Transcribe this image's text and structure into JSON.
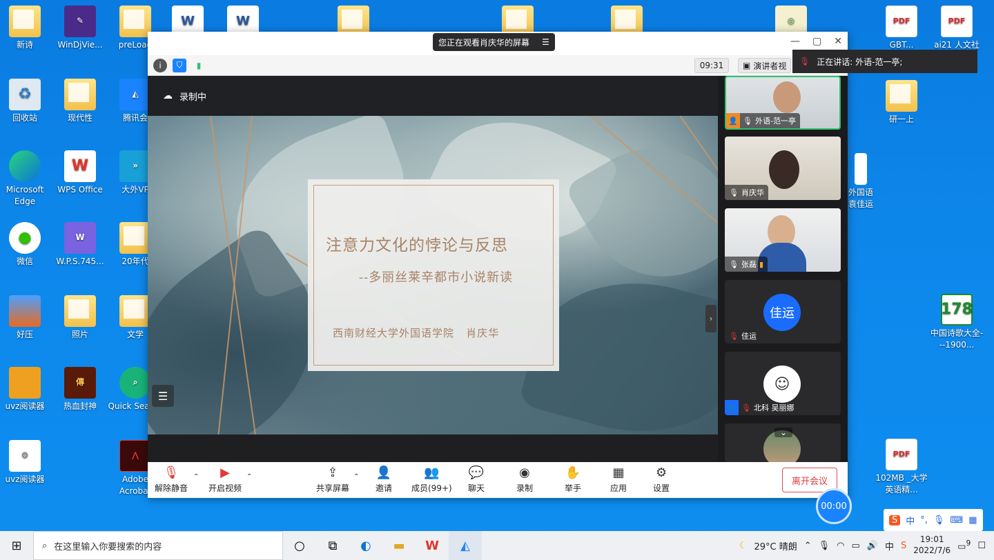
{
  "desktop": {
    "icons": [
      {
        "label": "新诗",
        "kind": "folder"
      },
      {
        "label": "WinDjVie...",
        "kind": "app"
      },
      {
        "label": "preLoad",
        "kind": "folder"
      },
      {
        "label": "回收站",
        "kind": "recycle"
      },
      {
        "label": "现代性",
        "kind": "folder"
      },
      {
        "label": "腾讯会",
        "kind": "app"
      },
      {
        "label": "Microsoft Edge",
        "kind": "app"
      },
      {
        "label": "WPS Office",
        "kind": "app"
      },
      {
        "label": "大外VP",
        "kind": "app"
      },
      {
        "label": "微信",
        "kind": "app"
      },
      {
        "label": "W.P.S.745...",
        "kind": "app"
      },
      {
        "label": "20年代",
        "kind": "folder"
      },
      {
        "label": "好压",
        "kind": "app"
      },
      {
        "label": "照片",
        "kind": "folder"
      },
      {
        "label": "文学",
        "kind": "folder"
      },
      {
        "label": "uvz阅读器",
        "kind": "app"
      },
      {
        "label": "热血封神",
        "kind": "app"
      },
      {
        "label": "Quick Search",
        "kind": "app"
      },
      {
        "label": "uvz阅读器",
        "kind": "file"
      },
      {
        "label": "Adobe Acrobat",
        "kind": "app"
      },
      {
        "label": "研一上",
        "kind": "folder"
      },
      {
        "label": "外国语\n袁佳运",
        "kind": "file"
      },
      {
        "label": "中国诗歌大全---1900...",
        "kind": "app"
      },
      {
        "label": "102MB _大学英语精...",
        "kind": "pdf"
      },
      {
        "label": "GBT...",
        "kind": "pdf"
      },
      {
        "label": "ai21 人文社",
        "kind": "pdf"
      }
    ],
    "pdf_badge": "PDF",
    "app178": "178"
  },
  "meeting": {
    "share_banner": "您正在观看肖庆华的屏幕",
    "time": "09:31",
    "view_mode": "演讲者视",
    "recording": "录制中",
    "speaking_label": "正在讲话: 外语-范一亭;",
    "slide": {
      "title": "注意力文化的悖论与反思",
      "subtitle": "--多丽丝莱辛都市小说新读",
      "footer": "西南财经大学外国语学院   肖庆华"
    },
    "participants": [
      {
        "name": "外语-范一亭",
        "active": true
      },
      {
        "name": "肖庆华",
        "active": false
      },
      {
        "name": "张磊",
        "active": false
      },
      {
        "name": "佳运",
        "active": false,
        "avatar_text": "佳运"
      },
      {
        "name": "北科 吴丽娜",
        "active": false
      },
      {
        "name": "",
        "active": false
      }
    ],
    "toolbar": {
      "unmute": "解除静音",
      "start_video": "开启视频",
      "share_screen": "共享屏幕",
      "invite": "邀请",
      "members": "成员(99+)",
      "chat": "聊天",
      "record": "录制",
      "raise_hand": "举手",
      "apps": "应用",
      "settings": "设置",
      "leave": "离开会议"
    },
    "timer": "00:00"
  },
  "taskbar": {
    "search_placeholder": "在这里输入你要搜索的内容",
    "weather": "29°C  晴朗",
    "ime": "中",
    "time": "19:01",
    "date": "2022/7/6",
    "notif_count": "9"
  },
  "ime_bar": {
    "lang": "中"
  },
  "colors": {
    "accent": "#1a83ff",
    "leave": "#e03a3a",
    "active_border": "#2ec36b"
  }
}
